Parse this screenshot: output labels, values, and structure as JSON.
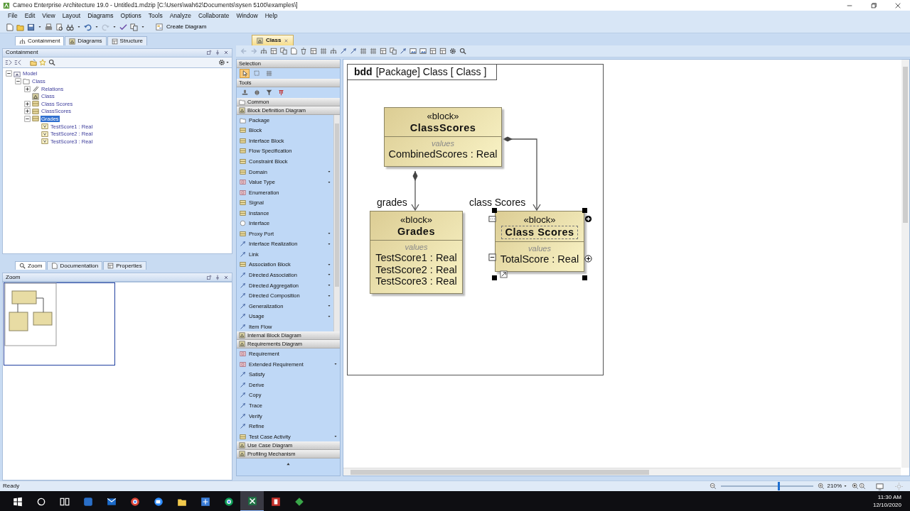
{
  "window": {
    "title": "Cameo Enterprise Architecture 19.0 - Untitled1.mdzip [C:\\Users\\wah62\\Documents\\sysen 5100\\examples\\]"
  },
  "menu": [
    "File",
    "Edit",
    "View",
    "Layout",
    "Diagrams",
    "Options",
    "Tools",
    "Analyze",
    "Collaborate",
    "Window",
    "Help"
  ],
  "toolbar": {
    "create_diagram": "Create Diagram"
  },
  "browser_tabs": [
    {
      "label": "Containment",
      "selected": true
    },
    {
      "label": "Diagrams",
      "selected": false
    },
    {
      "label": "Structure",
      "selected": false
    }
  ],
  "containment": {
    "title": "Containment",
    "tree": [
      {
        "label": "Model",
        "kind": "model",
        "expanded": true,
        "selected": false,
        "children": [
          {
            "label": "Class",
            "kind": "package",
            "expanded": true,
            "selected": false,
            "children": [
              {
                "label": "Relations",
                "kind": "relations",
                "expanded": false,
                "selected": false
              },
              {
                "label": "Class",
                "kind": "diagram",
                "selected": false
              },
              {
                "label": "Class Scores",
                "kind": "block",
                "expanded": false,
                "selected": false
              },
              {
                "label": "ClassScores",
                "kind": "block",
                "expanded": false,
                "selected": false
              },
              {
                "label": "Grades",
                "kind": "block",
                "expanded": true,
                "selected": true,
                "children": [
                  {
                    "label": "TestScore1 : Real",
                    "kind": "property",
                    "selected": false
                  },
                  {
                    "label": "TestScore2 : Real",
                    "kind": "property",
                    "selected": false
                  },
                  {
                    "label": "TestScore3 : Real",
                    "kind": "property",
                    "selected": false
                  }
                ]
              }
            ]
          }
        ]
      }
    ]
  },
  "lower_tabs": [
    {
      "label": "Zoom",
      "selected": true
    },
    {
      "label": "Documentation",
      "selected": false
    },
    {
      "label": "Properties",
      "selected": false
    }
  ],
  "zoom_panel": {
    "title": "Zoom"
  },
  "diagram_tabs": [
    {
      "label": "Class",
      "selected": true
    }
  ],
  "palette": {
    "groups": [
      {
        "title": "Selection",
        "kind": "tools",
        "tools": [
          {
            "kind": "pointer",
            "selected": true
          },
          {
            "kind": "marquee",
            "selected": false
          },
          {
            "kind": "grid",
            "selected": false
          }
        ]
      },
      {
        "title": "Tools",
        "kind": "tools",
        "tools": [
          {
            "kind": "stamp",
            "selected": false
          },
          {
            "kind": "paint",
            "selected": false
          },
          {
            "kind": "filter",
            "selected": false
          },
          {
            "kind": "text",
            "selected": false
          }
        ]
      },
      {
        "title": "Common",
        "kind": "section"
      },
      {
        "title": "Block Definition Diagram",
        "kind": "section",
        "items": [
          {
            "label": "Package",
            "kind": "package",
            "menu": false
          },
          {
            "label": "Block",
            "kind": "block",
            "menu": false
          },
          {
            "label": "Interface Block",
            "kind": "block",
            "menu": false
          },
          {
            "label": "Flow Specification",
            "kind": "block",
            "menu": false
          },
          {
            "label": "Constraint Block",
            "kind": "block",
            "menu": false
          },
          {
            "label": "Domain",
            "kind": "block",
            "menu": true
          },
          {
            "label": "Value Type",
            "kind": "element",
            "menu": true
          },
          {
            "label": "Enumeration",
            "kind": "element",
            "menu": false
          },
          {
            "label": "Signal",
            "kind": "block",
            "menu": false
          },
          {
            "label": "Instance",
            "kind": "block",
            "menu": false
          },
          {
            "label": "Interface",
            "kind": "circle",
            "menu": false
          },
          {
            "label": "Proxy Port",
            "kind": "block",
            "menu": true
          },
          {
            "label": "Interface Realization",
            "kind": "relation",
            "menu": true
          },
          {
            "label": "Link",
            "kind": "relation",
            "menu": false
          },
          {
            "label": "Association Block",
            "kind": "block",
            "menu": true
          },
          {
            "label": "Directed Association",
            "kind": "relation",
            "menu": true
          },
          {
            "label": "Directed Aggregation",
            "kind": "relation",
            "menu": true
          },
          {
            "label": "Directed Composition",
            "kind": "relation",
            "menu": true
          },
          {
            "label": "Generalization",
            "kind": "relation",
            "menu": true
          },
          {
            "label": "Usage",
            "kind": "relation",
            "menu": true
          },
          {
            "label": "Item Flow",
            "kind": "relation",
            "menu": false
          }
        ]
      },
      {
        "title": "Internal Block Diagram",
        "kind": "section"
      },
      {
        "title": "Requirements Diagram",
        "kind": "section",
        "items": [
          {
            "label": "Requirement",
            "kind": "element",
            "menu": false
          },
          {
            "label": "Extended Requirement",
            "kind": "element",
            "menu": true
          },
          {
            "label": "Satisfy",
            "kind": "relation",
            "menu": false
          },
          {
            "label": "Derive",
            "kind": "relation",
            "menu": false
          },
          {
            "label": "Copy",
            "kind": "relation",
            "menu": false
          },
          {
            "label": "Trace",
            "kind": "relation",
            "menu": false
          },
          {
            "label": "Verify",
            "kind": "relation",
            "menu": false
          },
          {
            "label": "Refine",
            "kind": "relation",
            "menu": false
          },
          {
            "label": "Test Case Activity",
            "kind": "block",
            "menu": true
          }
        ]
      },
      {
        "title": "Use Case Diagram",
        "kind": "section"
      },
      {
        "title": "Profiling Mechanism",
        "kind": "section"
      }
    ]
  },
  "diagram": {
    "frame_kind": "bdd",
    "frame_title": "[Package] Class [ Class ]",
    "blocks": [
      {
        "stereotype": "«block»",
        "name": "ClassScores",
        "compartment": "values",
        "properties": [
          "CombinedScores : Real"
        ],
        "selected": false
      },
      {
        "stereotype": "«block»",
        "name": "Grades",
        "compartment": "values",
        "properties": [
          "TestScore1 : Real",
          "TestScore2 : Real",
          "TestScore3 : Real"
        ],
        "selected": false
      },
      {
        "stereotype": "«block»",
        "name": "Class Scores",
        "compartment": "values",
        "properties": [
          "TotalScore : Real"
        ],
        "selected": true
      }
    ],
    "associations": [
      {
        "role": "grades"
      },
      {
        "role": "class Scores"
      }
    ]
  },
  "status_bar": {
    "text": "Ready",
    "zoom": {
      "level": 0.62,
      "reading": "210%"
    }
  },
  "taskbar": {
    "time": "11:30 AM",
    "date": "12/10/2020"
  }
}
